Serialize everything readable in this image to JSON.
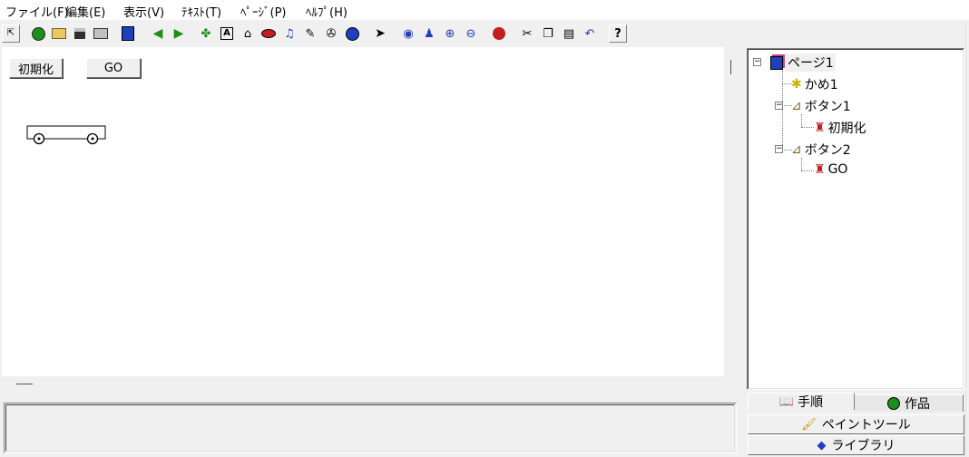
{
  "menu": [
    "ファイル(F)",
    "編集(E)",
    "表示(V)",
    "ﾃｷｽﾄ(T)",
    "ﾍﾟｰｼﾞ(P)",
    "ﾍﾙﾌﾟ(H)"
  ],
  "toolbar": {
    "icons": [
      "restore-icon",
      "new-icon",
      "open-folder-icon",
      "save-icon",
      "print-icon",
      "layout-icon",
      "back-arrow-icon",
      "forward-arrow-icon",
      "turtle-add-icon",
      "text-box-icon",
      "button-icon",
      "eye-switch-icon",
      "music-icon",
      "pencil-icon",
      "movie-icon",
      "globe-icon",
      "pointer-icon",
      "view-icon",
      "stamp-icon",
      "zoom-in-icon",
      "zoom-out-icon",
      "stop-icon",
      "cut-icon",
      "copy-icon",
      "paste-icon",
      "undo-icon",
      "help-icon"
    ],
    "help_label": "?"
  },
  "canvas": {
    "button_reset": "初期化",
    "button_go": "GO"
  },
  "tree": {
    "root": "ページ1",
    "turtle": "かめ1",
    "button1": "ボタン1",
    "button1_child": "初期化",
    "button2": "ボタン2",
    "button2_child": "GO"
  },
  "tabs": {
    "steps": "手順",
    "works": "作品"
  },
  "tools": {
    "paint": "ペイントツール",
    "library": "ライブラリ"
  },
  "colors": {
    "accent_blue": "#1f3fbf",
    "green": "#1a8f1a",
    "red": "#c02020"
  }
}
